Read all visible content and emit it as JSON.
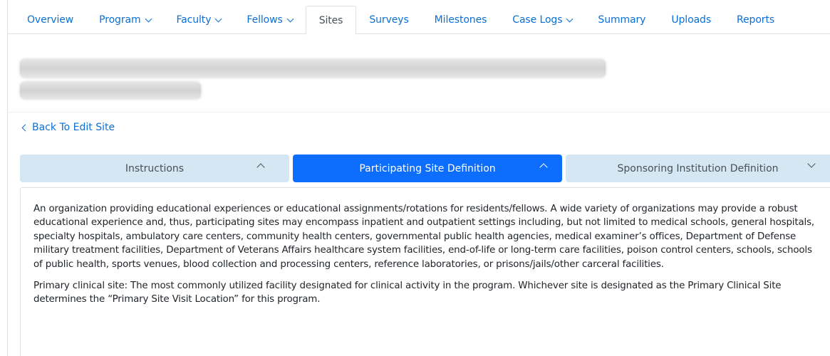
{
  "nav": {
    "tabs": [
      {
        "label": "Overview",
        "dropdown": false,
        "active": false
      },
      {
        "label": "Program",
        "dropdown": true,
        "active": false
      },
      {
        "label": "Faculty",
        "dropdown": true,
        "active": false
      },
      {
        "label": "Fellows",
        "dropdown": true,
        "active": false
      },
      {
        "label": "Sites",
        "dropdown": false,
        "active": true
      },
      {
        "label": "Surveys",
        "dropdown": false,
        "active": false
      },
      {
        "label": "Milestones",
        "dropdown": false,
        "active": false
      },
      {
        "label": "Case Logs",
        "dropdown": true,
        "active": false
      },
      {
        "label": "Summary",
        "dropdown": false,
        "active": false
      },
      {
        "label": "Uploads",
        "dropdown": false,
        "active": false
      },
      {
        "label": "Reports",
        "dropdown": false,
        "active": false
      }
    ]
  },
  "back_link": {
    "label": "Back To Edit Site"
  },
  "accordion": {
    "sections": [
      {
        "label": "Instructions",
        "expanded": true,
        "active": false
      },
      {
        "label": "Participating Site Definition",
        "expanded": true,
        "active": true
      },
      {
        "label": "Sponsoring Institution Definition",
        "expanded": false,
        "active": false
      }
    ]
  },
  "content": {
    "paragraph_1": "An organization providing educational experiences or educational assignments/rotations for residents/fellows. A wide variety of organizations may provide a robust educational experience and, thus, participating sites may encompass inpatient and outpatient settings including, but not limited to medical schools, general hospitals, specialty hospitals, ambulatory care centers, community health centers, governmental public health agencies, medical examiner’s offices, Department of Defense military treatment facilities, Department of Veterans Affairs healthcare system facilities, end-of-life or long-term care facilities, poison control centers, schools, schools of public health, sports venues, blood collection and processing centers, reference laboratories, or prisons/jails/other carceral facilities.",
    "paragraph_2": "Primary clinical site: The most commonly utilized facility designated for clinical activity in the program. Whichever site is designated as the Primary Clinical Site determines the “Primary Site Visit Location” for this program."
  },
  "colors": {
    "link": "#0b6fd6",
    "accordion_active": "#0d6efd",
    "accordion_inactive": "#d4e7f2"
  }
}
